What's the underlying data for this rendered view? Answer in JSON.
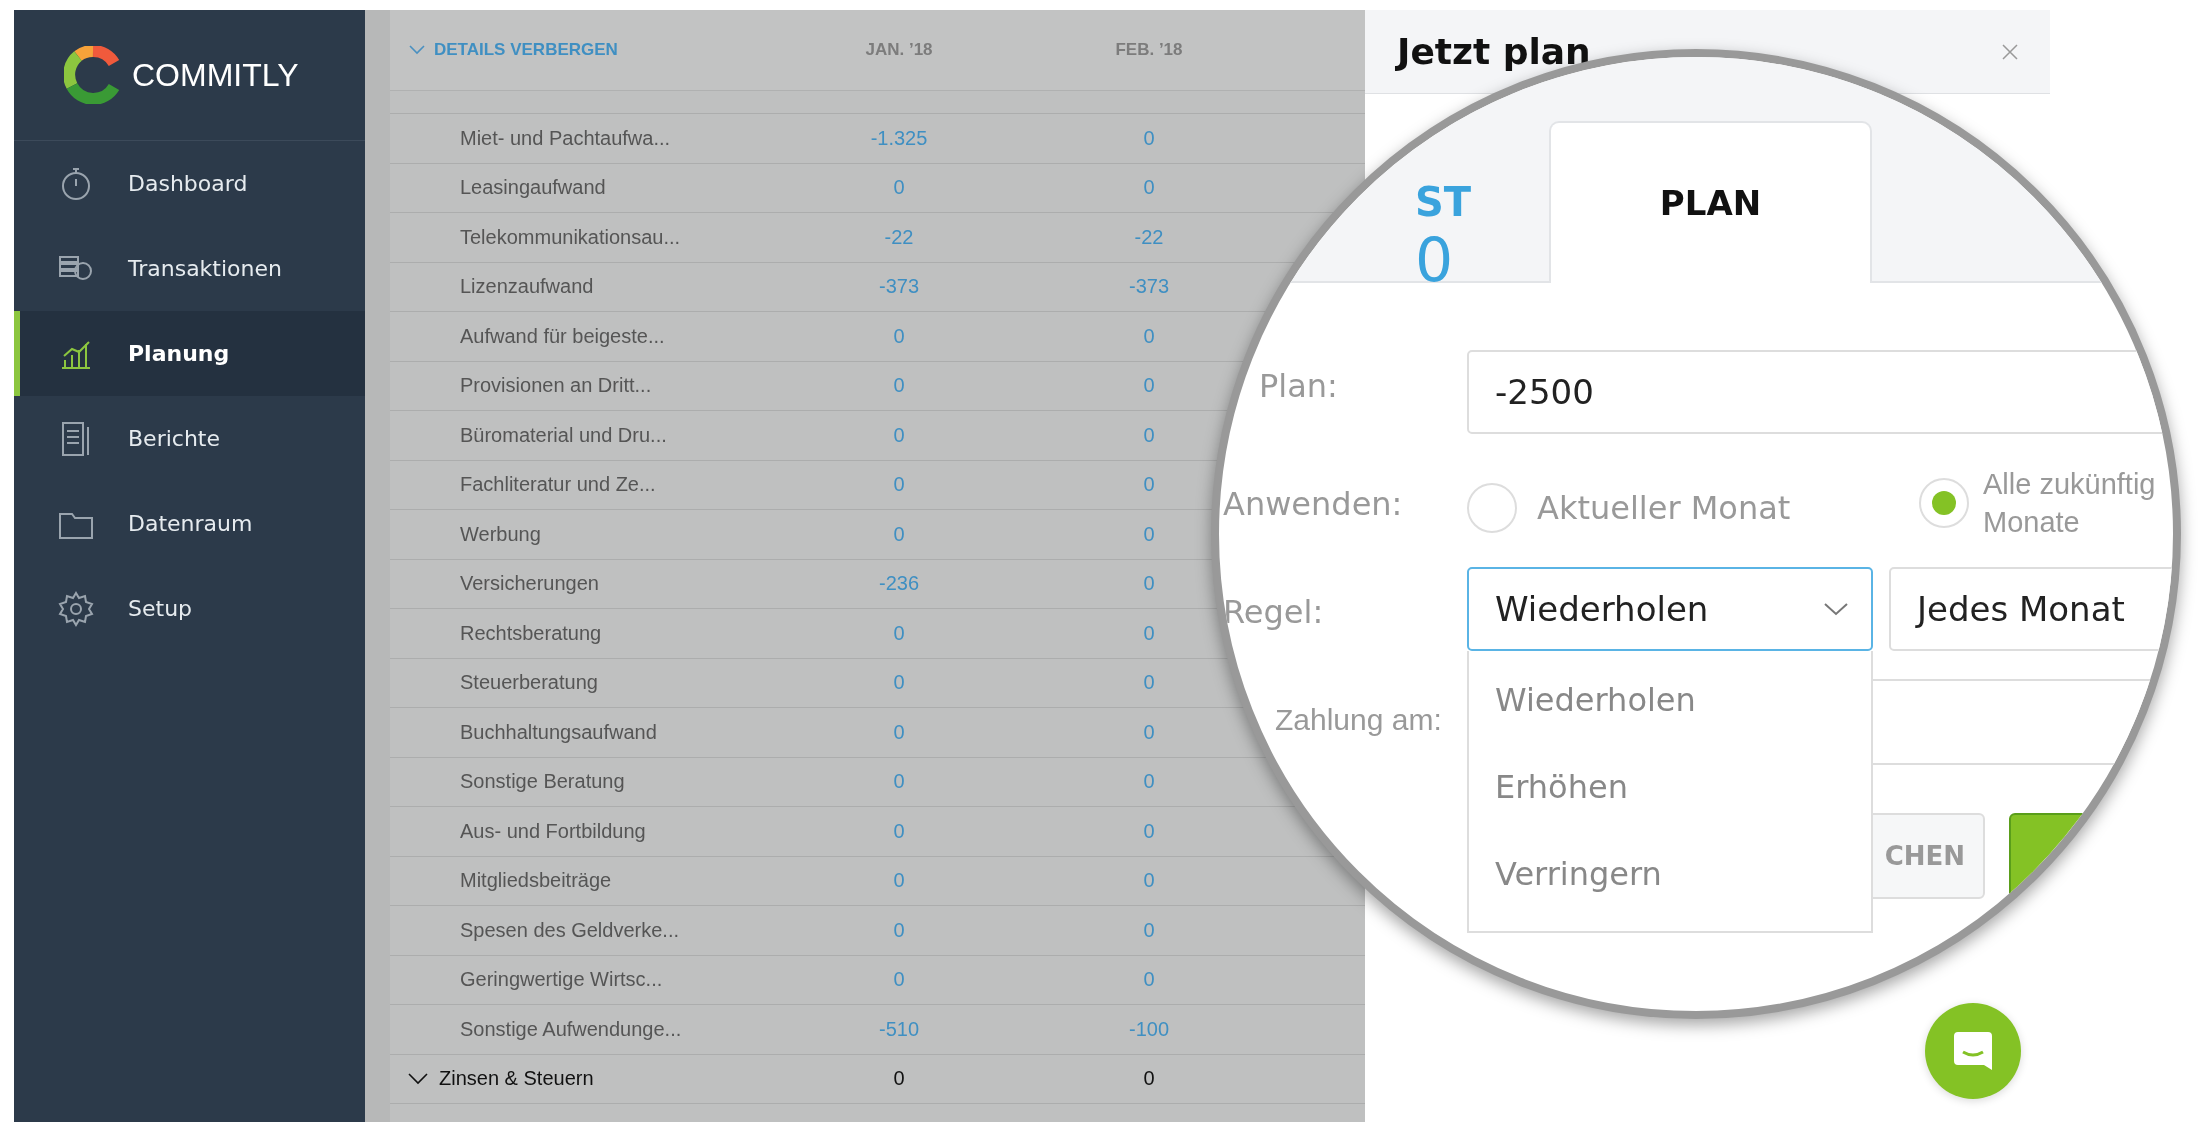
{
  "sidebar": {
    "logo": "COMMITLY",
    "items": [
      {
        "label": "Dashboard",
        "selected": false
      },
      {
        "label": "Transaktionen",
        "selected": false
      },
      {
        "label": "Planung",
        "selected": true
      },
      {
        "label": "Berichte",
        "selected": false
      },
      {
        "label": "Datenraum",
        "selected": false
      },
      {
        "label": "Setup",
        "selected": false
      }
    ]
  },
  "table": {
    "toggle": "DETAILS VERBERGEN",
    "columns": [
      "JAN. ’18",
      "FEB. ’18"
    ],
    "rows": [
      {
        "kind": "item",
        "label": "Miet- und Pachtaufwa...",
        "values": [
          "-1.325",
          "0"
        ]
      },
      {
        "kind": "item",
        "label": "Leasingaufwand",
        "values": [
          "0",
          "0"
        ]
      },
      {
        "kind": "item",
        "label": "Telekommunikationsau...",
        "values": [
          "-22",
          "-22"
        ]
      },
      {
        "kind": "item",
        "label": "Lizenzaufwand",
        "values": [
          "-373",
          "-373"
        ]
      },
      {
        "kind": "item",
        "label": "Aufwand für beigeste...",
        "values": [
          "0",
          "0"
        ]
      },
      {
        "kind": "item",
        "label": "Provisionen an Dritt...",
        "values": [
          "0",
          "0"
        ]
      },
      {
        "kind": "item",
        "label": "Büromaterial und Dru...",
        "values": [
          "0",
          "0"
        ]
      },
      {
        "kind": "item",
        "label": "Fachliteratur und Ze...",
        "values": [
          "0",
          "0"
        ]
      },
      {
        "kind": "item",
        "label": "Werbung",
        "values": [
          "0",
          "0"
        ]
      },
      {
        "kind": "item",
        "label": "Versicherungen",
        "values": [
          "-236",
          "0"
        ]
      },
      {
        "kind": "item",
        "label": "Rechtsberatung",
        "values": [
          "0",
          "0"
        ]
      },
      {
        "kind": "item",
        "label": "Steuerberatung",
        "values": [
          "0",
          "0"
        ]
      },
      {
        "kind": "item",
        "label": "Buchhaltungsaufwand",
        "values": [
          "0",
          "0"
        ]
      },
      {
        "kind": "item",
        "label": "Sonstige Beratung",
        "values": [
          "0",
          "0"
        ]
      },
      {
        "kind": "item",
        "label": "Aus- und Fortbildung",
        "values": [
          "0",
          "0"
        ]
      },
      {
        "kind": "item",
        "label": "Mitgliedsbeiträge",
        "values": [
          "0",
          "0"
        ]
      },
      {
        "kind": "item",
        "label": "Spesen des Geldverke...",
        "values": [
          "0",
          "0"
        ]
      },
      {
        "kind": "item",
        "label": "Geringwertige Wirtsc...",
        "values": [
          "0",
          "0"
        ]
      },
      {
        "kind": "item",
        "label": "Sonstige Aufwendunge...",
        "values": [
          "-510",
          "-100"
        ]
      },
      {
        "kind": "group",
        "label": "Zinsen & Steuern",
        "expanded": true,
        "values": [
          "0",
          "0"
        ]
      }
    ]
  },
  "panel": {
    "title": "Jetzt plan"
  },
  "magnifier": {
    "tabs": [
      {
        "label": "ST",
        "value": "0",
        "selected": false
      },
      {
        "label": "PLAN",
        "selected": true
      }
    ],
    "plan": {
      "label": "Plan:",
      "value": "-2500"
    },
    "apply": {
      "label": "Anwenden:",
      "options": [
        {
          "label": "Aktueller Monat",
          "selected": false
        },
        {
          "label": "Alle zukünftig\nMonate",
          "selected": true
        }
      ]
    },
    "rule": {
      "label": "Regel:",
      "value": "Wiederholen",
      "open": true,
      "options": [
        "Wiederholen",
        "Erhöhen",
        "Verringern"
      ],
      "interval": "Jedes Monat"
    },
    "payment": {
      "label": "Zahlung am:"
    },
    "buttons": [
      {
        "kind": "secondary",
        "label": "CHEN"
      },
      {
        "kind": "primary"
      }
    ]
  }
}
